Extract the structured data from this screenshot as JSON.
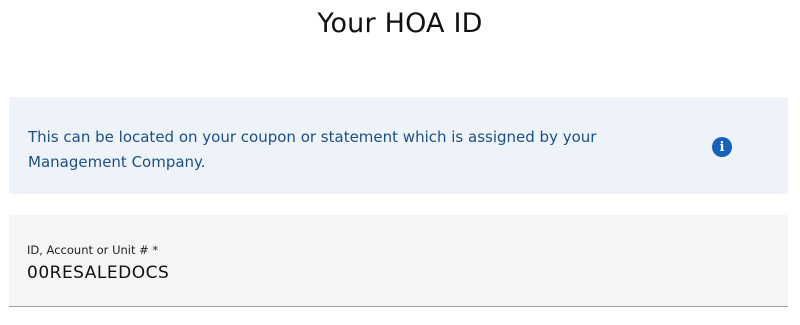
{
  "page": {
    "title": "Your HOA ID"
  },
  "info": {
    "text": "This can be located on your coupon or statement which is assigned by your Management Company.",
    "icon": "info-icon",
    "icon_glyph": "i",
    "accent_color": "#1462bc"
  },
  "field": {
    "label": "ID, Account or Unit # *",
    "value": "00RESALEDOCS"
  }
}
